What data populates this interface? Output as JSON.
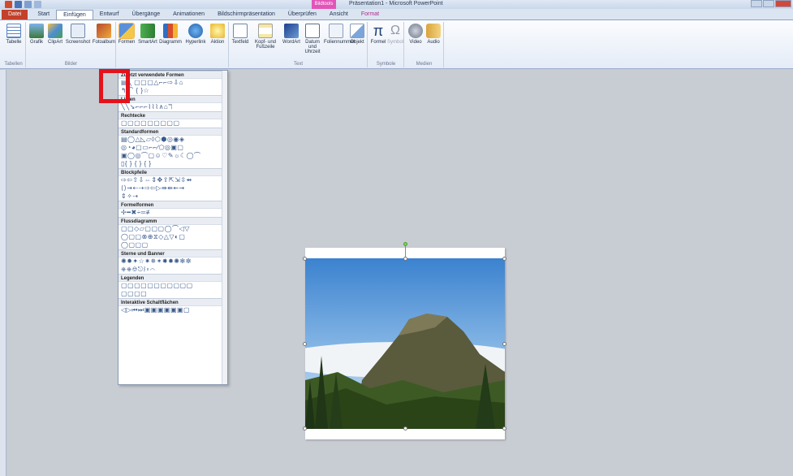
{
  "window": {
    "title": "Präsentation1 - Microsoft PowerPoint",
    "context_tab_header": "Bildtools"
  },
  "tabs": [
    "Datei",
    "Start",
    "Einfügen",
    "Entwurf",
    "Übergänge",
    "Animationen",
    "Bildschirmpräsentation",
    "Überprüfen",
    "Ansicht",
    "Format"
  ],
  "ribbon": {
    "groups": {
      "tabellen": "Tabellen",
      "bilder": "Bilder",
      "text": "Text",
      "symbole": "Symbole",
      "medien": "Medien"
    },
    "buttons": {
      "tabelle": "Tabelle",
      "grafik": "Grafik",
      "clipart": "ClipArt",
      "screenshot": "Screenshot",
      "fotoalbum": "Fotoalbum",
      "formen": "Formen",
      "smartart": "SmartArt",
      "diagramm": "Diagramm",
      "hyperlink": "Hyperlink",
      "aktion": "Aktion",
      "textfeld": "Textfeld",
      "kopf_fusszeile": "Kopf- und Fußzeile",
      "wordart": "WordArt",
      "datum_uhrzeit": "Datum und Uhrzeit",
      "foliennummer": "Foliennummer",
      "objekt": "Objekt",
      "formel": "Formel",
      "symbol": "Symbol",
      "video": "Video",
      "audio": "Audio"
    }
  },
  "gallery": {
    "sections": {
      "zuletzt": "Zuletzt verwendete Formen",
      "linien": "Linien",
      "rechtecke": "Rechtecke",
      "standard": "Standardformen",
      "blockpfeile": "Blockpfeile",
      "formel": "Formelformen",
      "fluss": "Flussdiagramm",
      "sterne": "Sterne und Banner",
      "legenden": "Legenden",
      "interaktiv": "Interaktive Schaltflächen"
    },
    "rows": {
      "zuletzt1": "▤╲ ▢▢▢△⌐⌐⇨⇩⌂",
      "zuletzt2": "↰⌒ { }☆",
      "linien1": "╲╲↘⌐⌐⌐⌇⌇⌇∧⌂ℸ",
      "rechtecke1": "▢▢▢▢▢▢▢▢▢",
      "std1": "▤◯△◺▱◊⬡⬢◎◉◈",
      "std2": "◎◔◕▢▭⌐⌐∕⬠◎▣▢",
      "std3": "▣◯◎⌒▢☺♡✎☼☾◯⌒",
      "std4": "▯{ } { } { }",
      "block1": "⇨⇦⇧⇩⇔⇕✥⇪⇱⇲⇳⇴",
      "block2": "⟨⟩⇝⇠⇢⇨⇦▷⇛⇚⇜⇝",
      "block3": "⇕✧⇢",
      "formel1": "✢━✖÷═≢",
      "fluss1": "▢▢◇▱▢▢▢◯⌒◁▽",
      "fluss2": "◯▢▢⊗⊕⧖◇△▽◐▢",
      "fluss3": "◯▢▢▢",
      "sterne1": "✺✹✦☆✷✵✶✸✹✺✻✼",
      "sterne2": "⎈⎈⎊⎋⌇⌑⌒",
      "legenden1": "▢▢▢▢▢▢▢▢▢▢▢",
      "legenden2": "▢▢▢▢",
      "interaktiv1": "◁▷⏮⏭▣▣▣▣▣▣▢"
    }
  }
}
